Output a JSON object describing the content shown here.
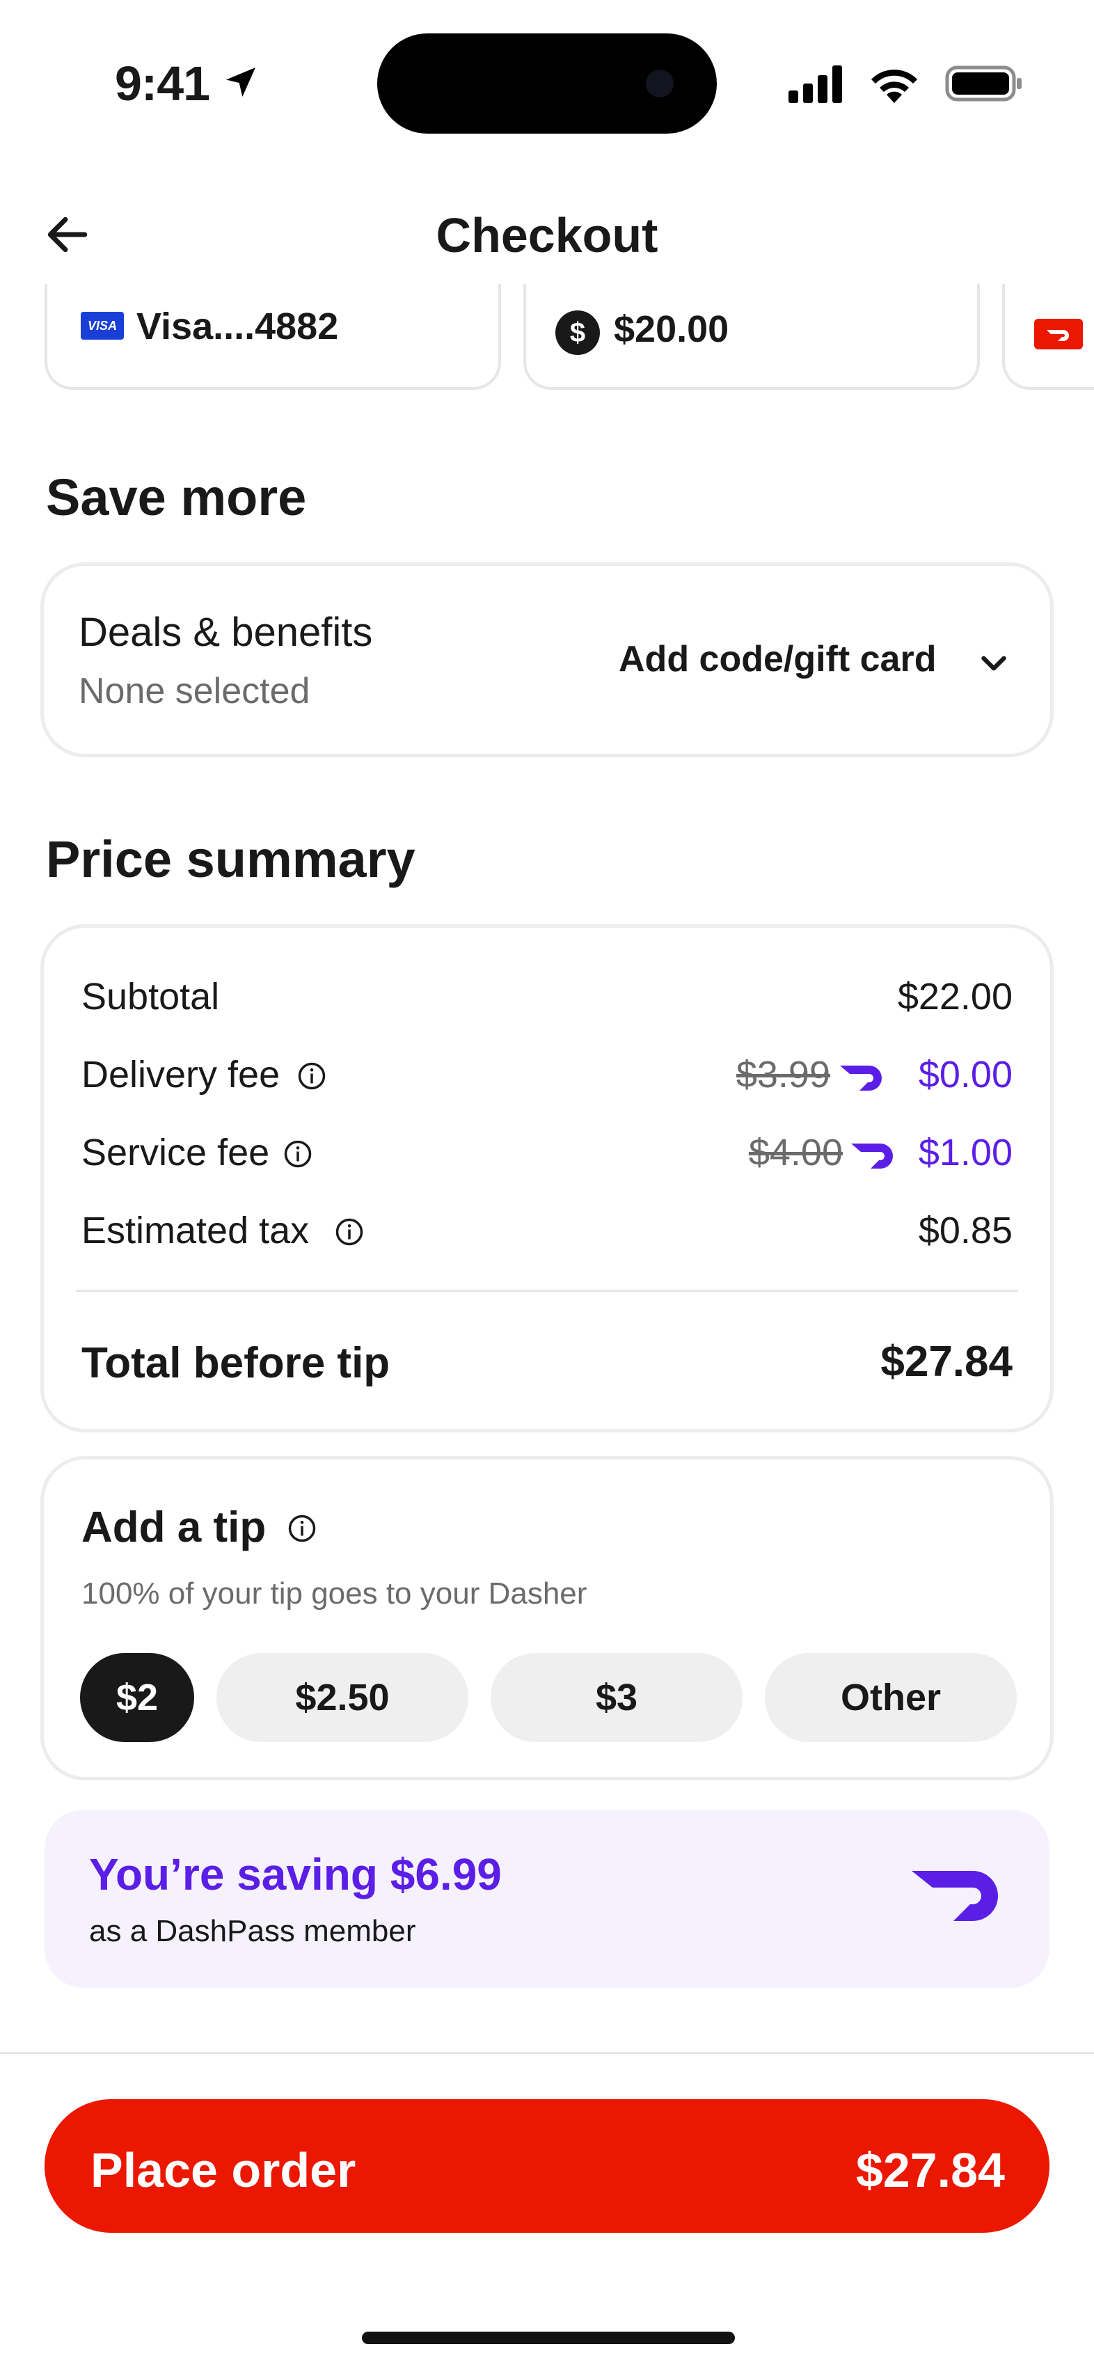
{
  "status_bar": {
    "time": "9:41"
  },
  "header": {
    "title": "Checkout"
  },
  "payment_methods": [
    {
      "label": "Visa....4882",
      "icon": "visa-logo",
      "badge_text": "VISA"
    },
    {
      "label": "$20.00",
      "icon": "dollar-circle-icon",
      "badge_text": "$"
    },
    {
      "label": "",
      "icon": "doordash-logo"
    }
  ],
  "save_more": {
    "section_title": "Save more",
    "deals_title": "Deals & benefits",
    "deals_status": "None selected",
    "add_code_label": "Add code/gift card"
  },
  "price_summary": {
    "section_title": "Price summary",
    "rows": [
      {
        "label": "Subtotal",
        "value": "$22.00"
      },
      {
        "label": "Delivery fee",
        "original": "$3.99",
        "value": "$0.00"
      },
      {
        "label": "Service fee",
        "original": "$4.00",
        "value": "$1.00"
      },
      {
        "label": "Estimated tax",
        "value": "$0.85"
      }
    ],
    "total_label": "Total before tip",
    "total_value": "$27.84"
  },
  "tip": {
    "title": "Add a tip",
    "subtitle": "100% of your tip goes to your Dasher",
    "options": [
      "$2",
      "$2.50",
      "$3",
      "Other"
    ],
    "selected": "$2"
  },
  "dashpass": {
    "title": "You’re saving $6.99",
    "subtitle": "as a DashPass member"
  },
  "footer": {
    "place_order_label": "Place order",
    "place_order_total": "$27.84"
  },
  "colors": {
    "brand_red": "#eb1700",
    "dashpass_purple": "#5b1ee6",
    "dashpass_bg": "#f5f2fe"
  }
}
